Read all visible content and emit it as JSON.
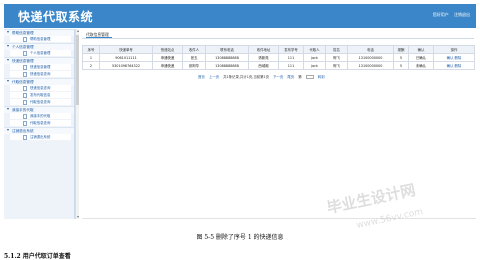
{
  "header": {
    "title": "快递代取系统",
    "links": [
      "您好用户",
      "注销退出"
    ]
  },
  "sidebar": {
    "groups": [
      {
        "title": "帮助信息管理",
        "items": [
          "帮助信息管理"
        ]
      },
      {
        "title": "个人信息管理",
        "items": [
          "个人信息管理"
        ]
      },
      {
        "title": "快递信息管理",
        "items": [
          "快递信息管理",
          "快递信息查询"
        ]
      },
      {
        "title": "代取信息管理",
        "items": [
          "快递信息查询",
          "发布代取信息",
          "代取信息查询"
        ]
      },
      {
        "title": "我接手的代取",
        "items": [
          "我接手的代取",
          "代取信息查询"
        ]
      },
      {
        "title": "注销退出系统",
        "items": [
          "注销退出系统"
        ]
      }
    ]
  },
  "main": {
    "tab": "代取信息管理",
    "table": {
      "headers": [
        "序号",
        "快递单号",
        "快递站点",
        "收件人",
        "联系电话",
        "收件地址",
        "发布学号",
        "代取人",
        "姓名",
        "电话",
        "报酬",
        "确认",
        "操作"
      ],
      "rows": [
        [
          "1",
          "9061011111",
          "申通快递",
          "张五",
          "13088888888",
          "清新苑",
          "111",
          "jack",
          "阿飞",
          "13100000000",
          "5",
          "已确认",
          "确认 删除"
        ],
        [
          "2",
          "5301098764322",
          "申通快递",
          "张阿华",
          "13088888888",
          "西域阁",
          "111",
          "jack",
          "阿飞",
          "13100000000",
          "5",
          "未确认",
          "确认 删除"
        ]
      ]
    },
    "pager": {
      "first": "首页",
      "prev": "上一页",
      "info": "共1条记录,共计1页,当前第1页",
      "next": "下一页",
      "last": "尾页",
      "jump_label": "第",
      "go": "转到"
    }
  },
  "caption": "图 5-5 删除了序号 1 的快递信息",
  "next_line": "5.1.2 用户代取订单查看",
  "watermark": {
    "text": "毕业生设计网",
    "url": "www.56vv.com"
  },
  "colors": {
    "header": "#3a86c8",
    "link": "#1f5fa8",
    "sidebar_bg": "#eef3fa"
  }
}
